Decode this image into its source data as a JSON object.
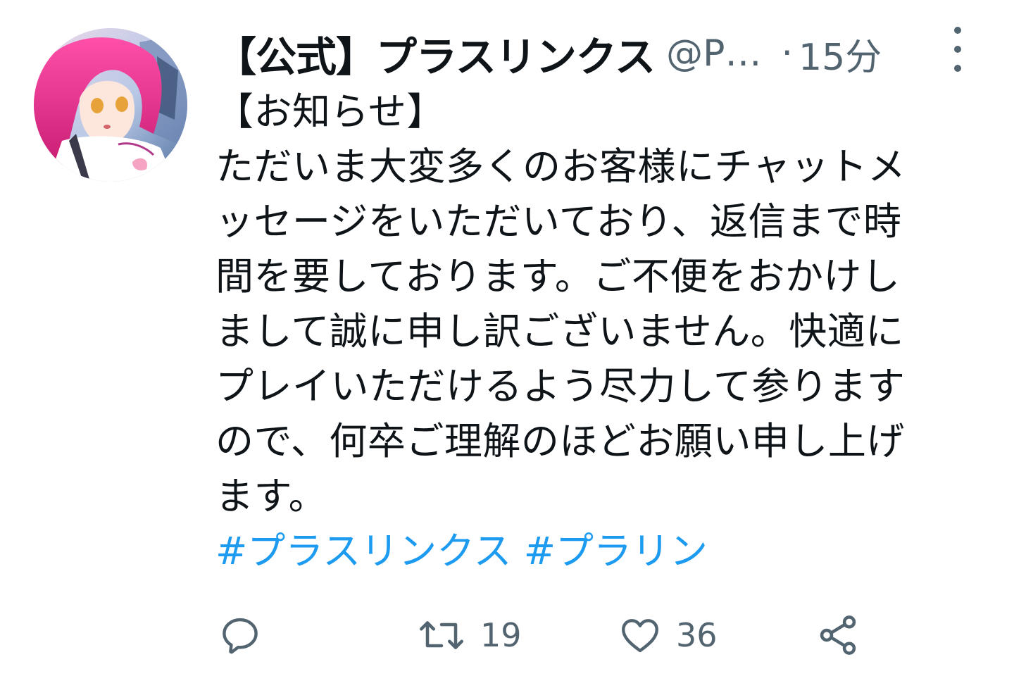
{
  "tweet": {
    "display_name": "【公式】プラスリンクス",
    "handle": "@P…",
    "separator": "·",
    "time": "15分",
    "body_lines": [
      "【お知らせ】",
      "ただいま大変多くのお客様にチャットメ",
      "ッセージをいただいており、返信まで時",
      "間を要しております。ご不便をおかけし",
      "まして誠に申し訳ございません。快適に",
      "プレイいただけるよう尽力して参ります",
      "ので、何卒ご理解のほどお願い申し上げ",
      "ます。"
    ],
    "hashtags": [
      "#プラスリンクス",
      "#プラリン"
    ]
  },
  "actions": {
    "reply": {
      "icon": "reply-icon"
    },
    "retweet": {
      "icon": "retweet-icon",
      "count": "19"
    },
    "like": {
      "icon": "heart-icon",
      "count": "36"
    },
    "share": {
      "icon": "share-icon"
    }
  },
  "colors": {
    "text": "#0f1419",
    "secondary": "#536471",
    "link": "#1d9bf0"
  }
}
